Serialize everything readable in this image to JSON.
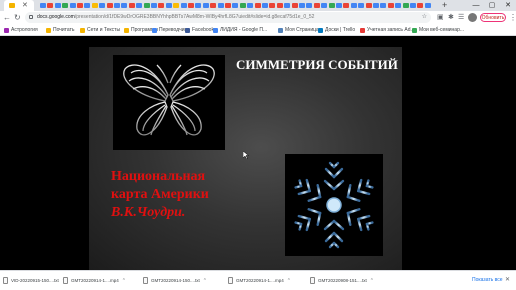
{
  "browser": {
    "tab_favicon_colors": [
      "#4285f4",
      "#ea4335",
      "#4285f4",
      "#34a853",
      "#4285f4",
      "#ea4335",
      "#4285f4",
      "#fbbc05",
      "#4285f4",
      "#ea4335",
      "#4285f4",
      "#4285f4",
      "#ea4335",
      "#4285f4",
      "#34a853",
      "#4285f4",
      "#ea4335",
      "#4285f4",
      "#fbbc05",
      "#4285f4",
      "#ea4335",
      "#4285f4",
      "#4285f4",
      "#ea4335",
      "#4285f4",
      "#ea4335",
      "#4285f4",
      "#34a853",
      "#4285f4",
      "#ea4335",
      "#4285f4",
      "#ea4335",
      "#ea4335",
      "#4285f4",
      "#ea4335",
      "#4285f4",
      "#4285f4",
      "#ea4335",
      "#4285f4",
      "#34a853",
      "#4285f4",
      "#ea4335",
      "#4285f4",
      "#4285f4",
      "#ea4335",
      "#4285f4",
      "#4285f4",
      "#ea4335",
      "#4285f4",
      "#34a853",
      "#4285f4",
      "#ea4335",
      "#4285f4",
      "#4285f4"
    ],
    "url_domain": "docs.google.com",
    "url_rest": "/presentation/d/1fDE9wDrOGRE3BBNYhhpBBTs7AwM8m-WIBy4hrfL8G7uiedit#slide=id.g8ecaf75d1e_0_52",
    "update_label": "Обновить",
    "kebab_icon": "⋮"
  },
  "bookmarks": [
    {
      "label": "Астрология",
      "color": "#9c27b0"
    },
    {
      "label": "Почитать",
      "color": "#f4b400"
    },
    {
      "label": "Сети и Тексты",
      "color": "#f4b400"
    },
    {
      "label": "Программы",
      "color": "#f4b400"
    },
    {
      "label": "Переводчик",
      "color": "#4285f4"
    },
    {
      "label": "Facebook",
      "color": "#3b5998"
    },
    {
      "label": "ЛИДИЯ - Google П...",
      "color": "#4285f4"
    },
    {
      "label": "Моя Страница",
      "color": "#5181b8"
    },
    {
      "label": "Доски | Trello",
      "color": "#0079bf"
    },
    {
      "label": "Учетная запись Ad...",
      "color": "#e53935"
    },
    {
      "label": "Мои веб-семинар...",
      "color": "#34a853"
    }
  ],
  "slide": {
    "title": "СИММЕТРИЯ СОБЫТИЙ",
    "line1": "Национальная",
    "line2": "карта Америки",
    "line3": "В.К.Чоудри."
  },
  "downloads": {
    "items": [
      {
        "name": "VID-20220915-150....txt"
      },
      {
        "name": "GMT20220914-1....mp4"
      },
      {
        "name": "GMT20220914-150....txt"
      },
      {
        "name": "GMT20220914-1....mp4"
      },
      {
        "name": "GMT20220908-151....txt"
      }
    ],
    "show_all": "Показать все"
  }
}
